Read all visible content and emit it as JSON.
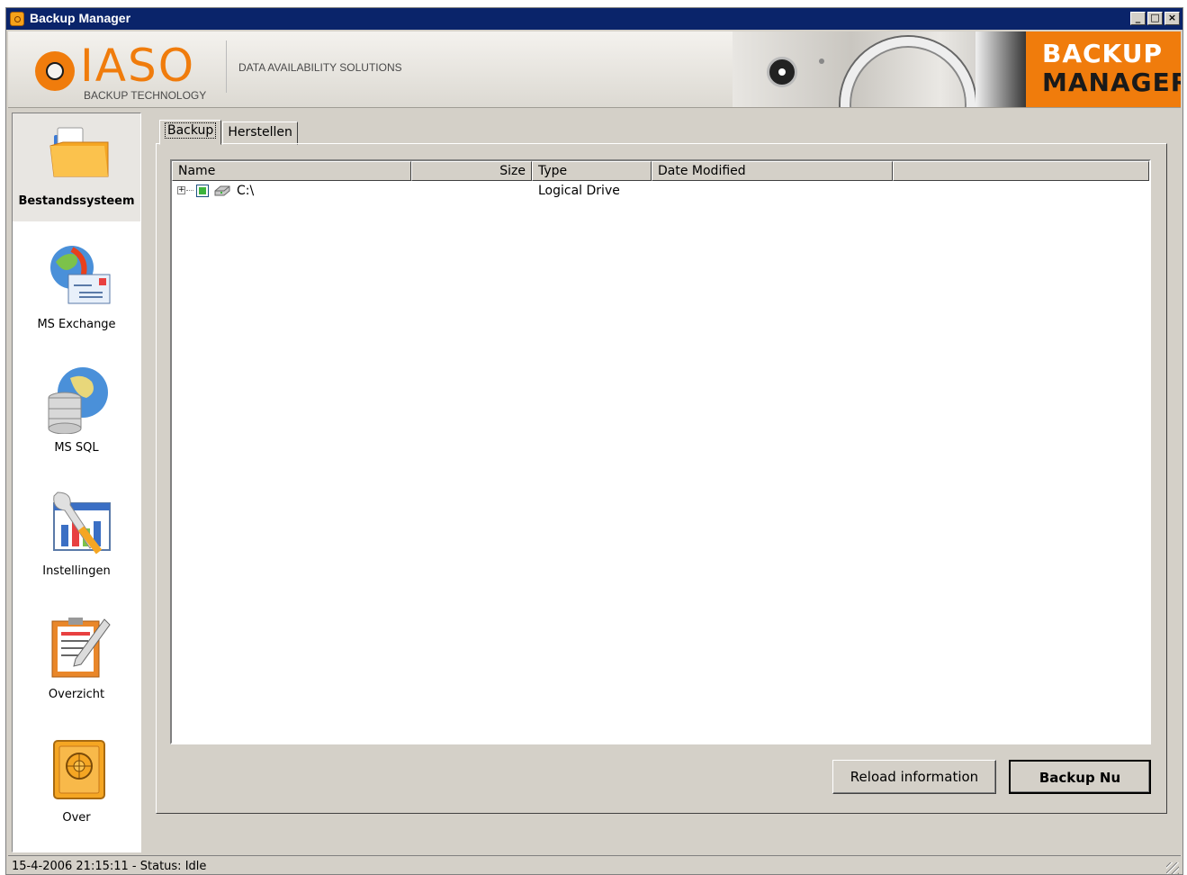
{
  "window": {
    "title": "Backup Manager",
    "controls": [
      "_",
      "□",
      "×"
    ]
  },
  "banner": {
    "logo_text": "IASO",
    "logo_sub": "BACKUP TECHNOLOGY",
    "tagline": "DATA AVAILABILITY SOLUTIONS",
    "product_line1": "BACKUP",
    "product_line2": "MANAGER"
  },
  "sidebar": {
    "items": [
      {
        "label": "Bestandssysteem",
        "icon": "folder-icon",
        "active": true
      },
      {
        "label": "MS Exchange",
        "icon": "exchange-mail-icon",
        "active": false
      },
      {
        "label": "MS SQL",
        "icon": "database-globe-icon",
        "active": false
      },
      {
        "label": "Instellingen",
        "icon": "settings-tools-icon",
        "active": false
      },
      {
        "label": "Overzicht",
        "icon": "report-clipboard-icon",
        "active": false
      },
      {
        "label": "Over",
        "icon": "safe-icon",
        "active": false
      }
    ]
  },
  "tabs": [
    {
      "label": "Backup",
      "active": true
    },
    {
      "label": "Herstellen",
      "active": false
    }
  ],
  "list": {
    "columns": [
      "Name",
      "Size",
      "Type",
      "Date Modified"
    ],
    "rows": [
      {
        "name": "C:\\",
        "size": "",
        "type": "Logical Drive",
        "modified": "",
        "checked": true,
        "expandable": true
      }
    ]
  },
  "buttons": {
    "reload": "Reload information",
    "backup_now": "Backup Nu"
  },
  "status": {
    "text": "15-4-2006 21:15:11  - Status: Idle"
  },
  "colors": {
    "accent": "#f07c0c",
    "titlebar": "#0a246a",
    "face": "#d4d0c8"
  }
}
